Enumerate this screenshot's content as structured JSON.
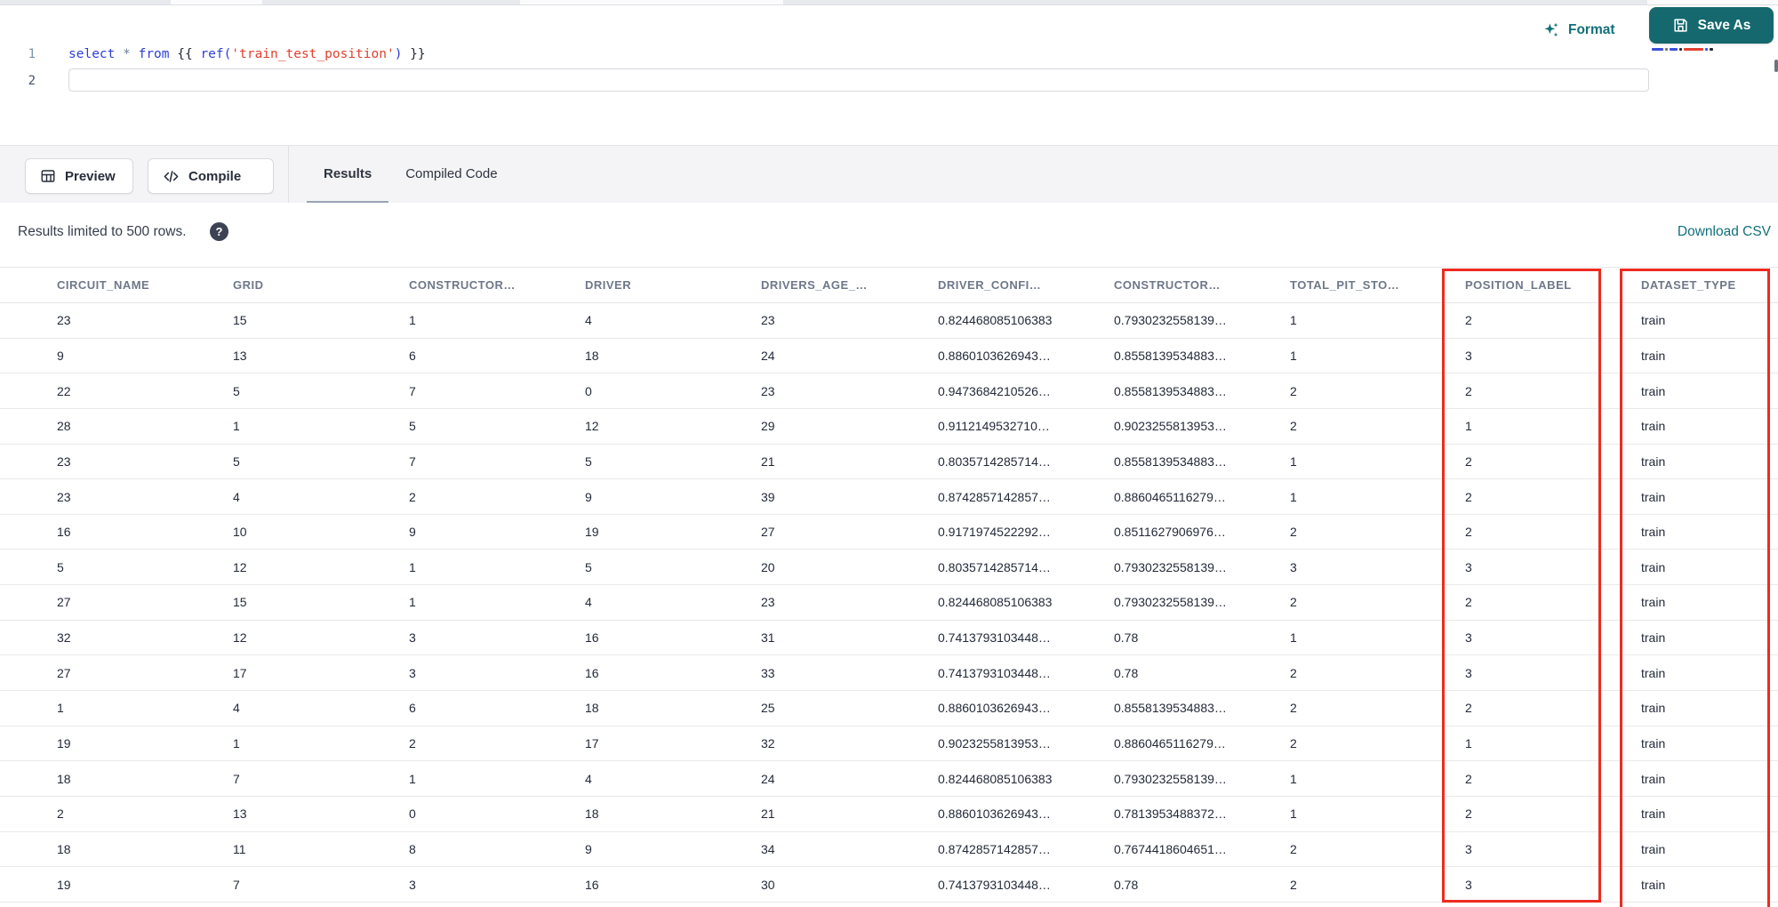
{
  "editor": {
    "line_numbers": [
      "1",
      "2"
    ],
    "code_tokens": [
      {
        "text": "select",
        "type": "keyword"
      },
      {
        "text": " ",
        "type": "plain"
      },
      {
        "text": "*",
        "type": "operator"
      },
      {
        "text": " ",
        "type": "plain"
      },
      {
        "text": "from",
        "type": "keyword"
      },
      {
        "text": " ",
        "type": "plain"
      },
      {
        "text": "{{",
        "type": "jinja"
      },
      {
        "text": " ",
        "type": "plain"
      },
      {
        "text": "ref(",
        "type": "function"
      },
      {
        "text": "'train_test_position'",
        "type": "string"
      },
      {
        "text": ")",
        "type": "function"
      },
      {
        "text": " ",
        "type": "plain"
      },
      {
        "text": "}}",
        "type": "jinja"
      }
    ],
    "format_label": "Format",
    "save_as_label": "Save As"
  },
  "toolbar": {
    "preview_label": "Preview",
    "compile_label": "Compile",
    "tabs": [
      {
        "label": "Results",
        "active": true
      },
      {
        "label": "Compiled Code",
        "active": false
      }
    ]
  },
  "results_bar": {
    "limit_text": "Results limited to 500 rows.",
    "help_icon": "?",
    "download_csv_label": "Download CSV"
  },
  "table": {
    "columns": [
      "CIRCUIT_NAME",
      "GRID",
      "CONSTRUCTOR…",
      "DRIVER",
      "DRIVERS_AGE_…",
      "DRIVER_CONFI…",
      "CONSTRUCTOR…",
      "TOTAL_PIT_STO…",
      "POSITION_LABEL",
      "DATASET_TYPE"
    ],
    "rows": [
      [
        "23",
        "15",
        "1",
        "4",
        "23",
        "0.824468085106383",
        "0.7930232558139…",
        "1",
        "2",
        "train"
      ],
      [
        "9",
        "13",
        "6",
        "18",
        "24",
        "0.8860103626943…",
        "0.8558139534883…",
        "1",
        "3",
        "train"
      ],
      [
        "22",
        "5",
        "7",
        "0",
        "23",
        "0.9473684210526…",
        "0.8558139534883…",
        "2",
        "2",
        "train"
      ],
      [
        "28",
        "1",
        "5",
        "12",
        "29",
        "0.9112149532710…",
        "0.9023255813953…",
        "2",
        "1",
        "train"
      ],
      [
        "23",
        "5",
        "7",
        "5",
        "21",
        "0.8035714285714…",
        "0.8558139534883…",
        "1",
        "2",
        "train"
      ],
      [
        "23",
        "4",
        "2",
        "9",
        "39",
        "0.8742857142857…",
        "0.8860465116279…",
        "1",
        "2",
        "train"
      ],
      [
        "16",
        "10",
        "9",
        "19",
        "27",
        "0.9171974522292…",
        "0.8511627906976…",
        "2",
        "2",
        "train"
      ],
      [
        "5",
        "12",
        "1",
        "5",
        "20",
        "0.8035714285714…",
        "0.7930232558139…",
        "3",
        "3",
        "train"
      ],
      [
        "27",
        "15",
        "1",
        "4",
        "23",
        "0.824468085106383",
        "0.7930232558139…",
        "2",
        "2",
        "train"
      ],
      [
        "32",
        "12",
        "3",
        "16",
        "31",
        "0.7413793103448…",
        "0.78",
        "1",
        "3",
        "train"
      ],
      [
        "27",
        "17",
        "3",
        "16",
        "33",
        "0.7413793103448…",
        "0.78",
        "2",
        "3",
        "train"
      ],
      [
        "1",
        "4",
        "6",
        "18",
        "25",
        "0.8860103626943…",
        "0.8558139534883…",
        "2",
        "2",
        "train"
      ],
      [
        "19",
        "1",
        "2",
        "17",
        "32",
        "0.9023255813953…",
        "0.8860465116279…",
        "2",
        "1",
        "train"
      ],
      [
        "18",
        "7",
        "1",
        "4",
        "24",
        "0.824468085106383",
        "0.7930232558139…",
        "1",
        "2",
        "train"
      ],
      [
        "2",
        "13",
        "0",
        "18",
        "21",
        "0.8860103626943…",
        "0.7813953488372…",
        "1",
        "2",
        "train"
      ],
      [
        "18",
        "11",
        "8",
        "9",
        "34",
        "0.8742857142857…",
        "0.7674418604651…",
        "2",
        "3",
        "train"
      ],
      [
        "19",
        "7",
        "3",
        "16",
        "30",
        "0.7413793103448…",
        "0.78",
        "2",
        "3",
        "train"
      ]
    ],
    "highlighted_columns": [
      "POSITION_LABEL",
      "DATASET_TYPE"
    ],
    "highlight_color": "#ee2b1f"
  },
  "colors": {
    "accent_teal_button": "#15696e",
    "accent_teal_text": "#12707a",
    "highlight_red": "#ee2b1f",
    "header_text": "#6e7889",
    "toolbar_bg": "#f4f4f6"
  }
}
